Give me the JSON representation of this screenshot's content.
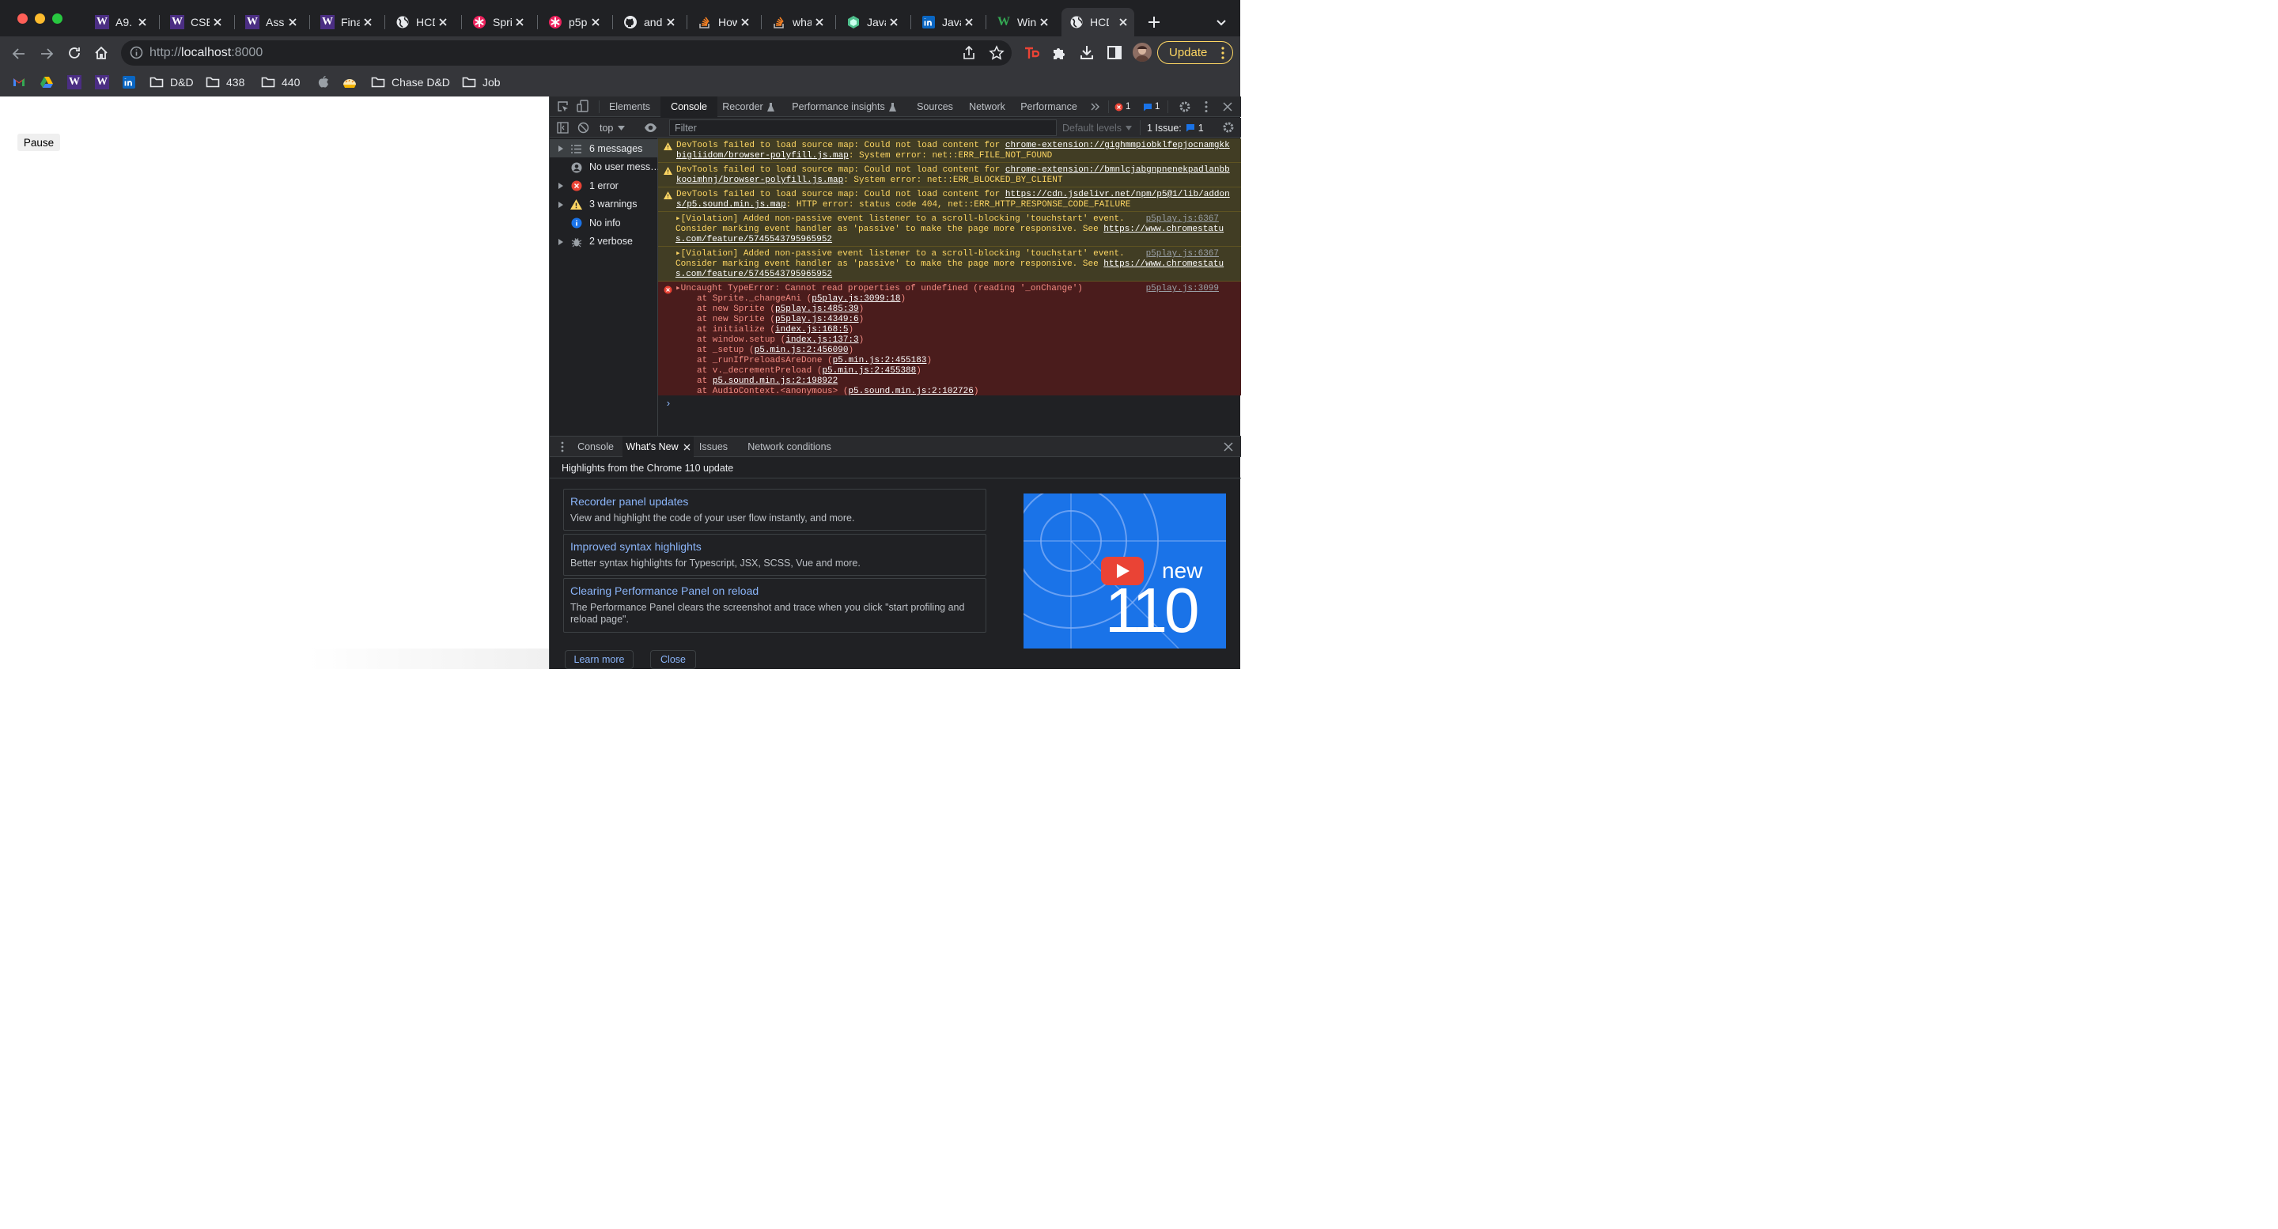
{
  "window": {
    "traffic_lights": [
      "#ff5f57",
      "#febc2e",
      "#28c840"
    ]
  },
  "tabs": [
    {
      "title": "A9.",
      "icon": "uw-w-icon"
    },
    {
      "title": "CSE",
      "icon": "uw-w-icon"
    },
    {
      "title": "Assi",
      "icon": "uw-w-icon"
    },
    {
      "title": "Fina",
      "icon": "uw-w-icon"
    },
    {
      "title": "HCD",
      "icon": "globe-icon"
    },
    {
      "title": "Spri",
      "icon": "p5-asterisk-icon"
    },
    {
      "title": "p5p",
      "icon": "p5-asterisk-icon"
    },
    {
      "title": "and",
      "icon": "github-icon"
    },
    {
      "title": "How",
      "icon": "stack-overflow-icon"
    },
    {
      "title": "wha",
      "icon": "stack-overflow-icon"
    },
    {
      "title": "Java",
      "icon": "hexagon-icon"
    },
    {
      "title": "Java",
      "icon": "linkedin-icon"
    },
    {
      "title": "Win",
      "icon": "wiki-w-icon"
    },
    {
      "title": "HCD",
      "icon": "globe-icon",
      "active": true
    }
  ],
  "toolbar": {
    "url_scheme": "http://",
    "url_host": "localhost",
    "url_port": ":8000",
    "update_label": "Update"
  },
  "bookmarks": [
    {
      "label": "",
      "icon": "gmail-icon"
    },
    {
      "label": "",
      "icon": "google-drive-icon"
    },
    {
      "label": "",
      "icon": "uw-w-icon"
    },
    {
      "label": "",
      "icon": "uw-w-icon"
    },
    {
      "label": "",
      "icon": "linkedin-icon"
    },
    {
      "label": "D&D",
      "icon": "folder-icon"
    },
    {
      "label": "438",
      "icon": "folder-icon"
    },
    {
      "label": "440",
      "icon": "folder-icon"
    },
    {
      "label": "",
      "icon": "apple-icon"
    },
    {
      "label": "",
      "icon": "pie-icon"
    },
    {
      "label": "Chase D&D",
      "icon": "folder-icon"
    },
    {
      "label": "Job",
      "icon": "folder-icon"
    }
  ],
  "page": {
    "pause_label": "Pause"
  },
  "devtools": {
    "tabs": [
      "Elements",
      "Console",
      "Recorder",
      "Performance insights",
      "Sources",
      "Network",
      "Performance"
    ],
    "error_count": "1",
    "message_count": "1",
    "context": "top",
    "filter_placeholder": "Filter",
    "levels_label": "Default levels",
    "issues_label": "1 Issue:",
    "issues_count": "1",
    "sidebar": [
      {
        "label": "6 messages",
        "icon": "list-icon"
      },
      {
        "label": "No user mess…",
        "icon": "user-icon"
      },
      {
        "label": "1 error",
        "icon": "error-icon"
      },
      {
        "label": "3 warnings",
        "icon": "warning-icon"
      },
      {
        "label": "No info",
        "icon": "info-icon"
      },
      {
        "label": "2 verbose",
        "icon": "bug-icon"
      }
    ],
    "messages": {
      "w1a": "DevTools failed to load source map: Could not load content for ",
      "w1b": "chrome-extension://gighmmpiobklfepjocnamgkk",
      "w1c": "bigliidom/browser-polyfill.js.map",
      "w1d": ": System error: net::ERR_FILE_NOT_FOUND",
      "w2a": "DevTools failed to load source map: Could not load content for ",
      "w2b": "chrome-extension://bmnlcjabgnpnenekpadlanbb",
      "w2c": "kooimhnj/browser-polyfill.js.map",
      "w2d": ": System error: net::ERR_BLOCKED_BY_CLIENT",
      "w3a": "DevTools failed to load source map: Could not load content for ",
      "w3b": "https://cdn.jsdelivr.net/npm/p5@1/lib/addon",
      "w3c": "s/p5.sound.min.js.map",
      "w3d": ": HTTP error: status code 404, net::ERR_HTTP_RESPONSE_CODE_FAILURE",
      "v1a": "▸[Violation] Added non-passive event listener to a scroll-blocking 'touchstart' event.",
      "v1b": "Consider marking event handler as 'passive' to make the page more responsive. See ",
      "v1c": "https://www.chromestatu",
      "v1d": "s.com/feature/5745543795965952",
      "v1src": "p5play.js:6367",
      "v2a": "▸[Violation] Added non-passive event listener to a scroll-blocking 'touchstart' event.",
      "v2b": "Consider marking event handler as 'passive' to make the page more responsive. See ",
      "v2c": "https://www.chromestatu",
      "v2d": "s.com/feature/5745543795965952",
      "v2src": "p5play.js:6367",
      "e_head": "▸Uncaught TypeError: Cannot read properties of undefined (reading '_onChange')",
      "e_src": "p5play.js:3099",
      "stack": [
        {
          "pre": "at Sprite._changeAni (",
          "loc": "p5play.js:3099:18",
          "post": ")"
        },
        {
          "pre": "at new Sprite (",
          "loc": "p5play.js:485:39",
          "post": ")"
        },
        {
          "pre": "at new Sprite (",
          "loc": "p5play.js:4349:6",
          "post": ")"
        },
        {
          "pre": "at initialize (",
          "loc": "index.js:168:5",
          "post": ")"
        },
        {
          "pre": "at window.setup (",
          "loc": "index.js:137:3",
          "post": ")"
        },
        {
          "pre": "at _setup (",
          "loc": "p5.min.js:2:456090",
          "post": ")"
        },
        {
          "pre": "at _runIfPreloadsAreDone (",
          "loc": "p5.min.js:2:455183",
          "post": ")"
        },
        {
          "pre": "at v._decrementPreload (",
          "loc": "p5.min.js:2:455388",
          "post": ")"
        },
        {
          "pre": "at ",
          "loc": "p5.sound.min.js:2:198922",
          "post": ""
        },
        {
          "pre": "at AudioContext.<anonymous> (",
          "loc": "p5.sound.min.js:2:102726",
          "post": ")"
        }
      ],
      "prompt": "›"
    },
    "drawer_tabs": [
      "Console",
      "What's New",
      "Issues",
      "Network conditions"
    ],
    "whats_new": {
      "headline": "Highlights from the Chrome 110 update",
      "cards": [
        {
          "title": "Recorder panel updates",
          "desc": "View and highlight the code of your user flow instantly, and more."
        },
        {
          "title": "Improved syntax highlights",
          "desc": "Better syntax highlights for Typescript, JSX, SCSS, Vue and more."
        },
        {
          "title": "Clearing Performance Panel on reload",
          "desc": "The Performance Panel clears the screenshot and trace when you click \"start profiling and reload page\"."
        }
      ],
      "promo_new": "new",
      "promo_version": "110",
      "learn_more": "Learn more",
      "close": "Close"
    }
  }
}
